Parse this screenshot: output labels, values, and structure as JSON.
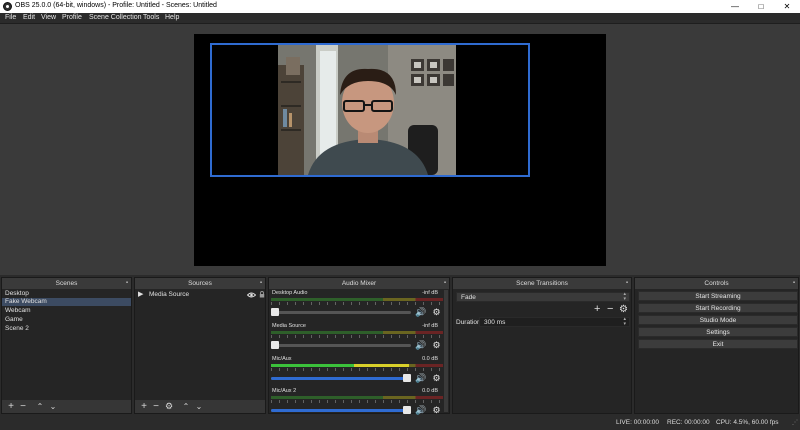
{
  "window": {
    "title": "OBS 25.0.0 (64-bit, windows) - Profile: Untitled - Scenes: Untitled",
    "minimize": "—",
    "maximize": "□",
    "close": "✕"
  },
  "menu": [
    "File",
    "Edit",
    "View",
    "Profile",
    "Scene Collection",
    "Tools",
    "Help"
  ],
  "scenes": {
    "title": "Scenes",
    "items": [
      "Desktop",
      "Fake Webcam",
      "Webcam",
      "Game",
      "Scene 2"
    ],
    "selected_index": 1
  },
  "sources": {
    "title": "Sources",
    "items": [
      {
        "name": "Media Source",
        "visible": true,
        "locked": false
      }
    ]
  },
  "mixer": {
    "title": "Audio Mixer",
    "channels": [
      {
        "name": "Desktop Audio",
        "db": "-inf dB",
        "level": 0.0,
        "volume": 0.0
      },
      {
        "name": "Media Source",
        "db": "-inf dB",
        "level": 0.0,
        "volume": 0.0
      },
      {
        "name": "Mic/Aux",
        "db": "0.0 dB",
        "level": 0.8,
        "volume": 1.0
      },
      {
        "name": "Mic/Aux 2",
        "db": "0.0 dB",
        "level": 0.0,
        "volume": 1.0
      }
    ]
  },
  "transitions": {
    "title": "Scene Transitions",
    "type": "Fade",
    "duration_label": "Duration",
    "duration_value": "300 ms"
  },
  "controls": {
    "title": "Controls",
    "buttons": [
      "Start Streaming",
      "Start Recording",
      "Studio Mode",
      "Settings",
      "Exit"
    ]
  },
  "status": {
    "live": "LIVE: 00:00:00",
    "rec": "REC: 00:00:00",
    "cpu": "CPU: 4.5%, 60.00 fps"
  },
  "colors": {
    "selection": "#3c4b62",
    "source_outline": "#2f6bd1",
    "volume": "#2f6bd1"
  }
}
